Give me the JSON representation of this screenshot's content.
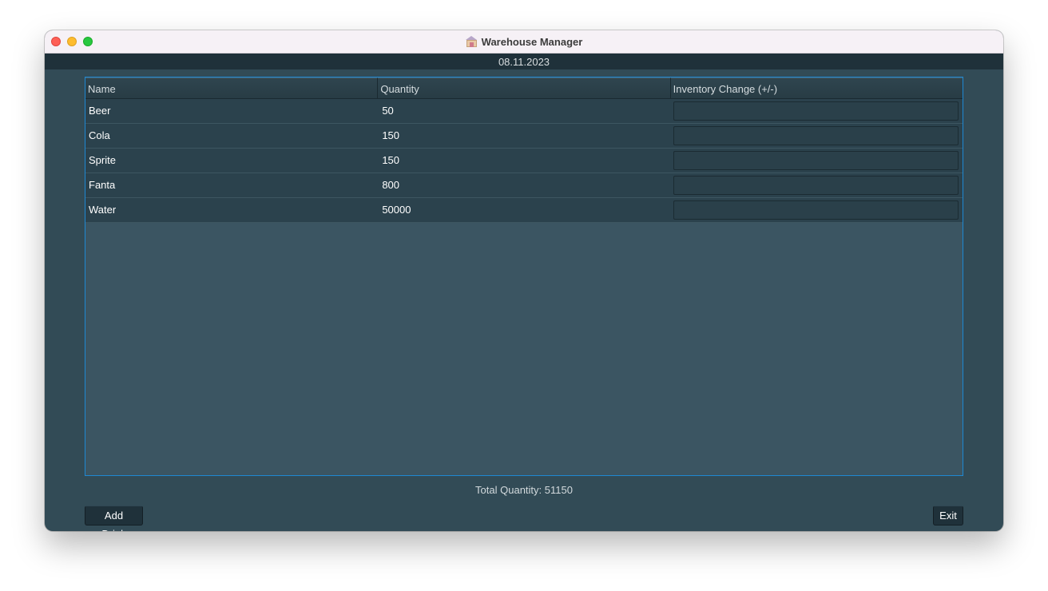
{
  "window": {
    "title": "Warehouse Manager",
    "icon": "warehouse-icon"
  },
  "header": {
    "date": "08.11.2023"
  },
  "table": {
    "columns": [
      "Name",
      "Quantity",
      "Inventory Change (+/-)"
    ],
    "rows": [
      {
        "name": "Beer",
        "quantity": "50",
        "change": ""
      },
      {
        "name": "Cola",
        "quantity": "150",
        "change": ""
      },
      {
        "name": "Sprite",
        "quantity": "150",
        "change": ""
      },
      {
        "name": "Fanta",
        "quantity": "800",
        "change": ""
      },
      {
        "name": "Water",
        "quantity": "50000",
        "change": ""
      }
    ]
  },
  "footer": {
    "total_label": "Total Quantity: 51150",
    "add_button": "Add Drink",
    "exit_button": "Exit"
  },
  "colors": {
    "background": "#324b56",
    "header_bar": "#1f313a",
    "accent_border": "#1e88d2"
  }
}
